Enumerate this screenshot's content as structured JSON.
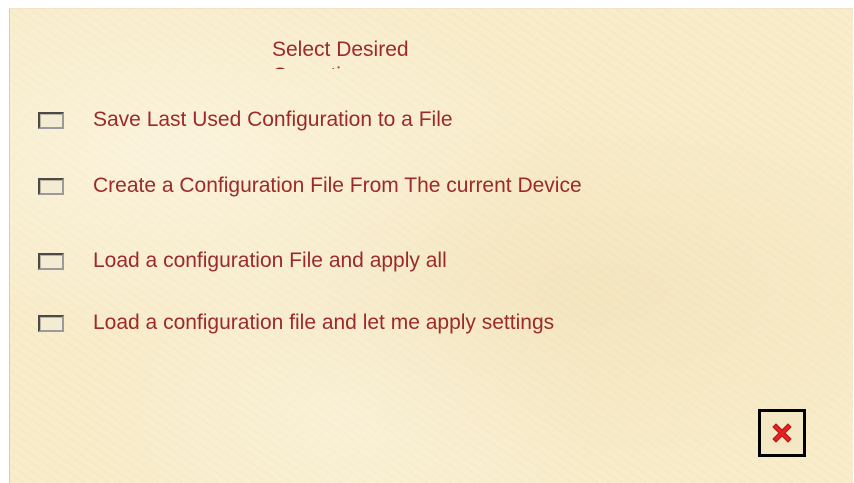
{
  "dialog": {
    "heading": "Select Desired",
    "heading_partial": "Operation",
    "options": [
      {
        "label": "Save Last Used Configuration to a File",
        "checked": false
      },
      {
        "label": "Create a Configuration File From The current Device",
        "checked": false
      },
      {
        "label": "Load a configuration File and apply all",
        "checked": false
      },
      {
        "label": "Load a configuration file and let me apply settings",
        "checked": false
      }
    ],
    "close_icon": "close-icon",
    "colors": {
      "background": "#f8ecc9",
      "text": "#9c2a2a",
      "close_icon": "#e32222"
    }
  }
}
